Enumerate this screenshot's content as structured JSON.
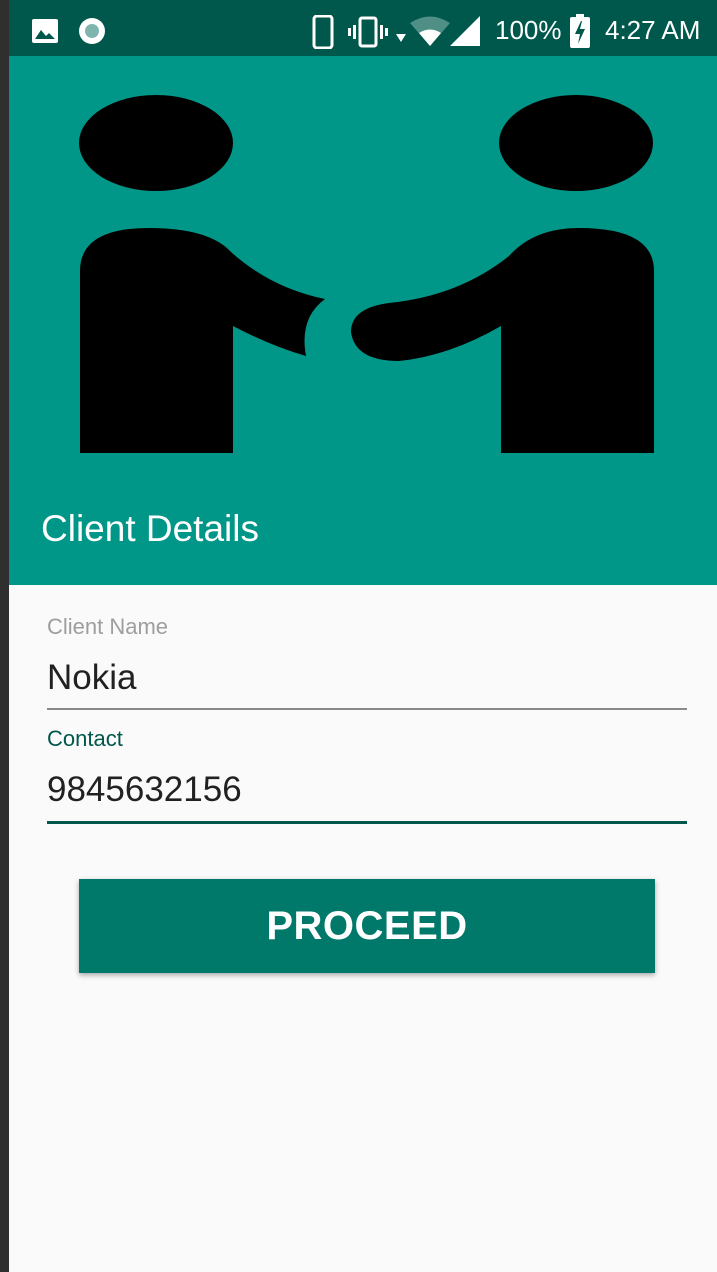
{
  "status_bar": {
    "battery": "100%",
    "time": "4:27 AM",
    "icons": [
      "image-icon",
      "record-icon",
      "phone-icon",
      "vibrate-icon",
      "data-arrows-icon",
      "wifi-icon",
      "signal-icon",
      "battery-charging-icon"
    ]
  },
  "header": {
    "title": "Client Details",
    "hero_image": "handshake-illustration"
  },
  "form": {
    "client_name_label": "Client Name",
    "client_name_value": "Nokia",
    "contact_label": "Contact",
    "contact_value": "9845632156"
  },
  "actions": {
    "proceed_label": "PROCEED"
  },
  "colors": {
    "status_bar": "#00574b",
    "primary": "#009688",
    "button": "#00796b",
    "focus_accent": "#00574b",
    "inactive_label": "#9e9e9e",
    "background": "#fafafa"
  }
}
